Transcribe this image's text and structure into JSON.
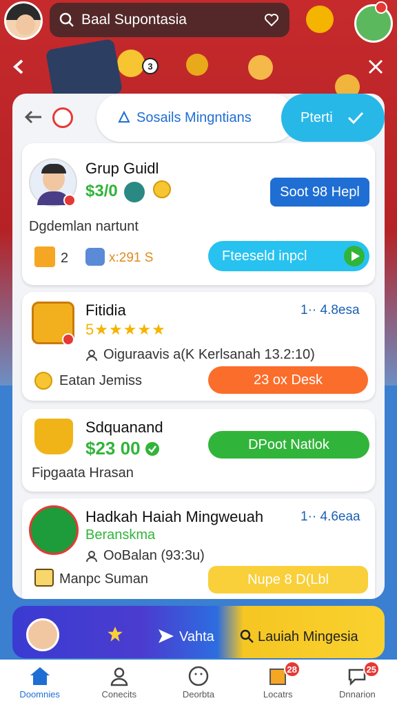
{
  "search": {
    "text": "Baal Supontasia"
  },
  "header": {
    "social_tab": "Sosails Mingntians",
    "priority_tab": "Pterti",
    "top_badge": "3"
  },
  "card1": {
    "title": "Grup Guidl",
    "amount": "$3/0",
    "subtitle": "Dgdemlan nartunt",
    "gift_count": "2",
    "score": "x:291 S",
    "primary_button": "Soot 98 Hepl",
    "action_button": "Fteeseld inpcl"
  },
  "card2": {
    "title": "Fitidia",
    "stars": "5★★★★★",
    "right_meta": "1·· 4.8esa",
    "detail": "Oiguraavis a(K Kerlsanah 13.2:10)",
    "coin_label": "Eatan Jemiss",
    "button": "23 ox Desk"
  },
  "card3": {
    "title": "Sdquanand",
    "price": "$23 00",
    "subtitle": "Fipgaata Hrasan",
    "button": "DPoot Natlok"
  },
  "card4": {
    "title": "Hadkah Haiah Mingweuah",
    "subtitle": "Beranskma",
    "right_meta": "1·· 4.6eaa",
    "detail": "OoBalan (93:3u)",
    "coin_label": "Manpc Suman",
    "button": "Nupe 8 D(Lbl"
  },
  "banner": {
    "left_label": "Vahta",
    "right_label": "Lauiah Mingesia"
  },
  "nav": {
    "items": [
      {
        "label": "Doomnies",
        "badge": ""
      },
      {
        "label": "Conecits",
        "badge": ""
      },
      {
        "label": "Deorbta",
        "badge": ""
      },
      {
        "label": "Locatrs",
        "badge": "28"
      },
      {
        "label": "Dnnarion",
        "badge": "25"
      }
    ]
  },
  "colors": {
    "accent_blue": "#1f6ed4",
    "sky_blue": "#27b8e8",
    "orange": "#fb6d2b",
    "green": "#31b43a",
    "yellow": "#f9cf3a",
    "red": "#b8262a"
  }
}
